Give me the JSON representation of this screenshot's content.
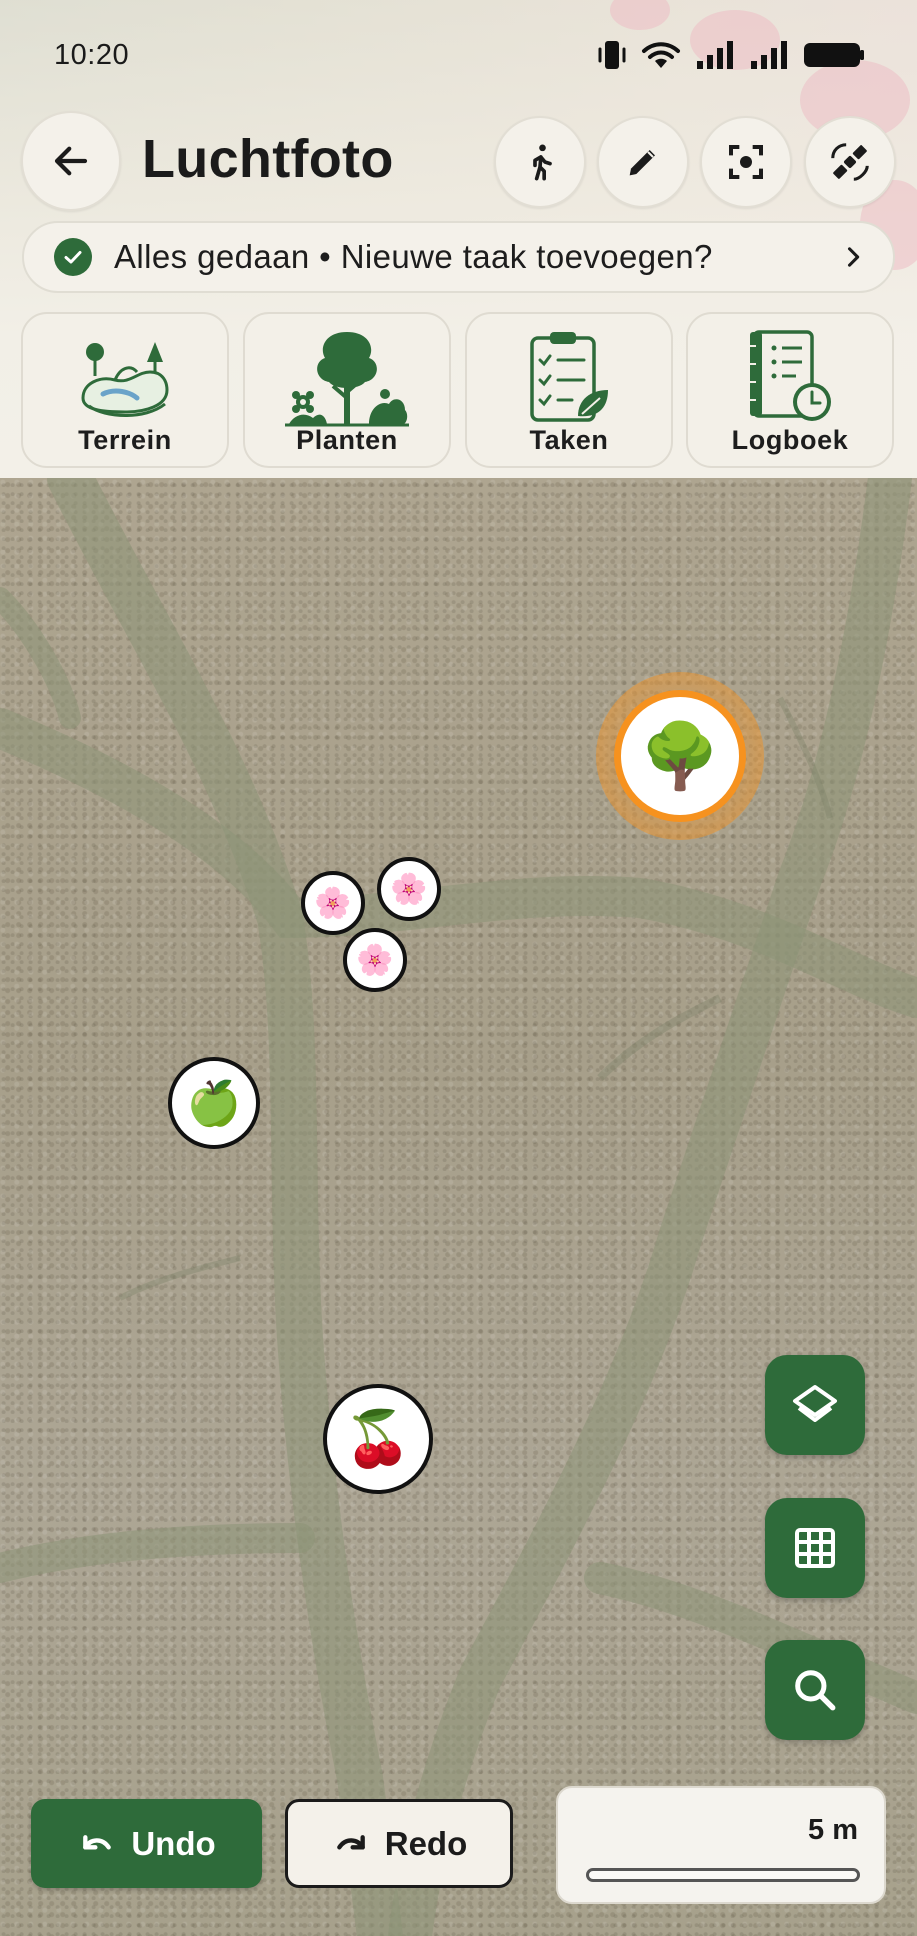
{
  "status_bar": {
    "time": "10:20",
    "icons": [
      "vibrate-icon",
      "wifi-icon",
      "signal-icon",
      "signal-icon",
      "battery-icon"
    ]
  },
  "header": {
    "title": "Luchtfoto",
    "back_icon": "arrow-left-icon",
    "actions": [
      {
        "name": "walk-mode-button",
        "icon": "person-walking-icon"
      },
      {
        "name": "edit-button",
        "icon": "pencil-icon"
      },
      {
        "name": "focus-button",
        "icon": "focus-frame-icon"
      },
      {
        "name": "satellite-button",
        "icon": "satellite-icon"
      }
    ]
  },
  "task_banner": {
    "text": "Alles gedaan • Nieuwe taak toevoegen?",
    "icon": "check-circle-icon"
  },
  "categories": [
    {
      "label": "Terrein",
      "icon": "landscape-icon"
    },
    {
      "label": "Planten",
      "icon": "plants-icon"
    },
    {
      "label": "Taken",
      "icon": "task-clipboard-icon"
    },
    {
      "label": "Logboek",
      "icon": "logbook-icon"
    }
  ],
  "map": {
    "markers": [
      {
        "name": "tree-marker",
        "emoji": "🌳",
        "selected": true,
        "accent": "#f6921f"
      },
      {
        "name": "blossom-marker",
        "emoji": "🌸"
      },
      {
        "name": "blossom-marker",
        "emoji": "🌸"
      },
      {
        "name": "blossom-marker",
        "emoji": "🌸"
      },
      {
        "name": "apple-marker",
        "emoji": "🍏"
      },
      {
        "name": "cherry-marker",
        "emoji": "🍒"
      }
    ],
    "fabs": [
      {
        "name": "layers-button",
        "icon": "layers-icon"
      },
      {
        "name": "grid-button",
        "icon": "grid-icon"
      },
      {
        "name": "search-button",
        "icon": "search-icon"
      }
    ]
  },
  "controls": {
    "undo_label": "Undo",
    "redo_label": "Redo",
    "scale_label": "5 m"
  },
  "colors": {
    "primary_green": "#2e6b3a",
    "selection_orange": "#f6921f",
    "surface": "#f3f0e8"
  }
}
